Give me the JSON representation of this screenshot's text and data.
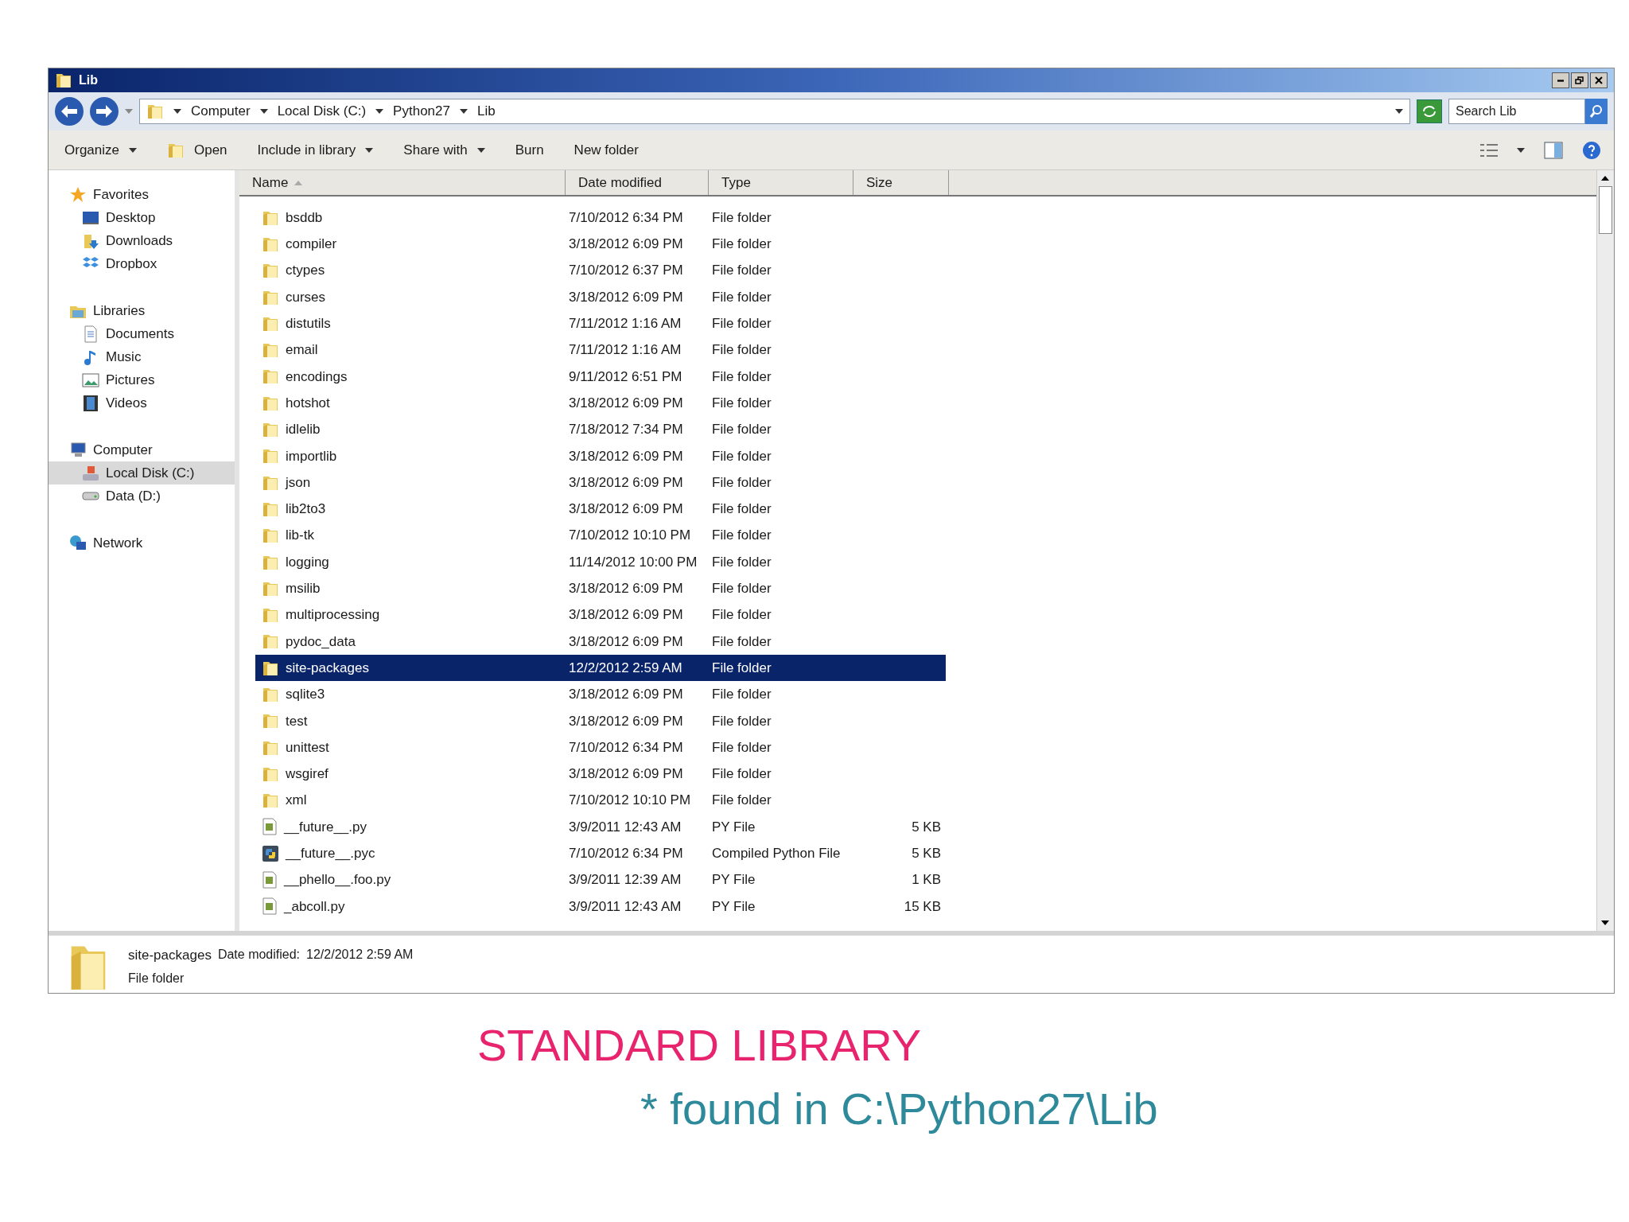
{
  "window": {
    "title": "Lib"
  },
  "address": {
    "crumbs": [
      "Computer",
      "Local Disk (C:)",
      "Python27",
      "Lib"
    ]
  },
  "search": {
    "placeholder": "Search Lib"
  },
  "toolbar": [
    {
      "label": "Organize",
      "kind": "menu"
    },
    {
      "label": "Open",
      "kind": "icon"
    },
    {
      "label": "Include in library",
      "kind": "menu"
    },
    {
      "label": "Share with",
      "kind": "menu"
    },
    {
      "label": "Burn",
      "kind": "plain"
    },
    {
      "label": "New folder",
      "kind": "plain"
    }
  ],
  "sidebar": [
    {
      "label": "Favorites",
      "children": [
        {
          "label": "Desktop",
          "selected": false
        },
        {
          "label": "Downloads",
          "selected": false
        },
        {
          "label": "Dropbox",
          "selected": false
        }
      ]
    },
    {
      "label": "Libraries",
      "children": [
        {
          "label": "Documents",
          "selected": false
        },
        {
          "label": "Music",
          "selected": false
        },
        {
          "label": "Pictures",
          "selected": false
        },
        {
          "label": "Videos",
          "selected": false
        }
      ]
    },
    {
      "label": "Computer",
      "children": [
        {
          "label": "Local Disk (C:)",
          "selected": true
        },
        {
          "label": "Data (D:)",
          "selected": false
        }
      ]
    },
    {
      "label": "Network"
    }
  ],
  "columns": [
    {
      "label": "Name",
      "sorted": true
    },
    {
      "label": "Date modified",
      "sorted": false
    },
    {
      "label": "Type",
      "sorted": false
    },
    {
      "label": "Size",
      "sorted": false
    }
  ],
  "rows": [
    {
      "name": "bsddb",
      "date": "7/10/2012 6:34 PM",
      "type": "File folder",
      "kind": "folder",
      "selected": false
    },
    {
      "name": "compiler",
      "date": "3/18/2012 6:09 PM",
      "type": "File folder",
      "kind": "folder",
      "selected": false
    },
    {
      "name": "ctypes",
      "date": "7/10/2012 6:37 PM",
      "type": "File folder",
      "kind": "folder",
      "selected": false
    },
    {
      "name": "curses",
      "date": "3/18/2012 6:09 PM",
      "type": "File folder",
      "kind": "folder",
      "selected": false
    },
    {
      "name": "distutils",
      "date": "7/11/2012 1:16 AM",
      "type": "File folder",
      "kind": "folder",
      "selected": false
    },
    {
      "name": "email",
      "date": "7/11/2012 1:16 AM",
      "type": "File folder",
      "kind": "folder",
      "selected": false
    },
    {
      "name": "encodings",
      "date": "9/11/2012 6:51 PM",
      "type": "File folder",
      "kind": "folder",
      "selected": false
    },
    {
      "name": "hotshot",
      "date": "3/18/2012 6:09 PM",
      "type": "File folder",
      "kind": "folder",
      "selected": false
    },
    {
      "name": "idlelib",
      "date": "7/18/2012 7:34 PM",
      "type": "File folder",
      "kind": "folder",
      "selected": false
    },
    {
      "name": "importlib",
      "date": "3/18/2012 6:09 PM",
      "type": "File folder",
      "kind": "folder",
      "selected": false
    },
    {
      "name": "json",
      "date": "3/18/2012 6:09 PM",
      "type": "File folder",
      "kind": "folder",
      "selected": false
    },
    {
      "name": "lib2to3",
      "date": "3/18/2012 6:09 PM",
      "type": "File folder",
      "kind": "folder",
      "selected": false
    },
    {
      "name": "lib-tk",
      "date": "7/10/2012 10:10 PM",
      "type": "File folder",
      "kind": "folder",
      "selected": false
    },
    {
      "name": "logging",
      "date": "11/14/2012 10:00 PM",
      "type": "File folder",
      "kind": "folder",
      "selected": false
    },
    {
      "name": "msilib",
      "date": "3/18/2012 6:09 PM",
      "type": "File folder",
      "kind": "folder",
      "selected": false
    },
    {
      "name": "multiprocessing",
      "date": "3/18/2012 6:09 PM",
      "type": "File folder",
      "kind": "folder",
      "selected": false
    },
    {
      "name": "pydoc_data",
      "date": "3/18/2012 6:09 PM",
      "type": "File folder",
      "kind": "folder",
      "selected": false
    },
    {
      "name": "site-packages",
      "date": "12/2/2012 2:59 AM",
      "type": "File folder",
      "kind": "folder",
      "selected": true
    },
    {
      "name": "sqlite3",
      "date": "3/18/2012 6:09 PM",
      "type": "File folder",
      "kind": "folder",
      "selected": false
    },
    {
      "name": "test",
      "date": "3/18/2012 6:09 PM",
      "type": "File folder",
      "kind": "folder",
      "selected": false
    },
    {
      "name": "unittest",
      "date": "7/10/2012 6:34 PM",
      "type": "File folder",
      "kind": "folder",
      "selected": false
    },
    {
      "name": "wsgiref",
      "date": "3/18/2012 6:09 PM",
      "type": "File folder",
      "kind": "folder",
      "selected": false
    },
    {
      "name": "xml",
      "date": "7/10/2012 10:10 PM",
      "type": "File folder",
      "kind": "folder",
      "selected": false
    },
    {
      "name": "__future__.py",
      "date": "3/9/2011 12:43 AM",
      "type": "PY File",
      "size": "5 KB",
      "kind": "py",
      "selected": false
    },
    {
      "name": "__future__.pyc",
      "date": "7/10/2012 6:34 PM",
      "type": "Compiled Python File",
      "size": "5 KB",
      "kind": "pyc",
      "selected": false
    },
    {
      "name": "__phello__.foo.py",
      "date": "3/9/2011 12:39 AM",
      "type": "PY File",
      "size": "1 KB",
      "kind": "py",
      "selected": false
    },
    {
      "name": "_abcoll.py",
      "date": "3/9/2011 12:43 AM",
      "type": "PY File",
      "size": "15 KB",
      "kind": "py",
      "selected": false
    }
  ],
  "details": {
    "name": "site-packages",
    "date_label": "Date modified:",
    "date": "12/2/2012 2:59 AM",
    "type": "File folder"
  },
  "slide": {
    "title": "STANDARD LIBRARY",
    "caption": "* found in C:\\Python27\\Lib"
  }
}
